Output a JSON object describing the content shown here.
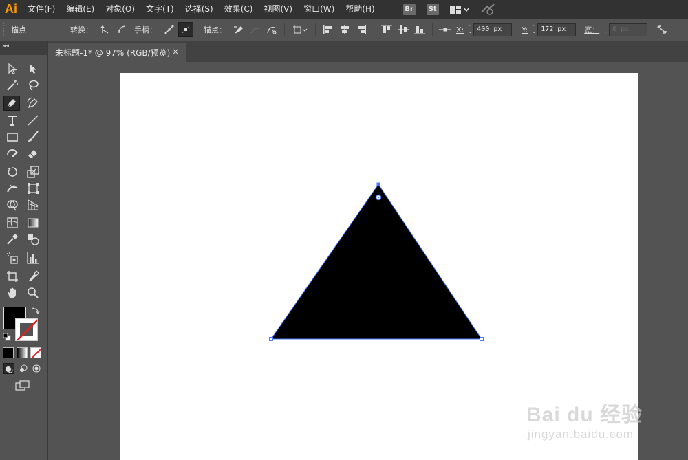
{
  "app": {
    "logo": "Ai"
  },
  "menu": [
    "文件(F)",
    "编辑(E)",
    "对象(O)",
    "文字(T)",
    "选择(S)",
    "效果(C)",
    "视图(V)",
    "窗口(W)",
    "帮助(H)"
  ],
  "bridge_label": "Br",
  "stock_label": "St",
  "control": {
    "anchor_label": "锚点",
    "convert_label": "转换：",
    "handles_label": "手柄：",
    "anchors_label": "锚点：",
    "x_label": "X:",
    "x_value": "400 px",
    "y_label": "Y:",
    "y_value": "172 px",
    "width_label": "宽：",
    "width_value": "0 px"
  },
  "document": {
    "tab_title": "未标题-1* @ 97% (RGB/预览)",
    "close": "×"
  },
  "swatches": {
    "fill": "#000000",
    "stroke": "none"
  },
  "toolbox": {
    "collapse": "◂◂"
  },
  "shape": {
    "type": "triangle",
    "fill": "#000000",
    "path_color": "#4a7bff",
    "selected": true
  },
  "watermark": {
    "main": "Bai du 经验",
    "sub": "jingyan.baidu.com"
  }
}
